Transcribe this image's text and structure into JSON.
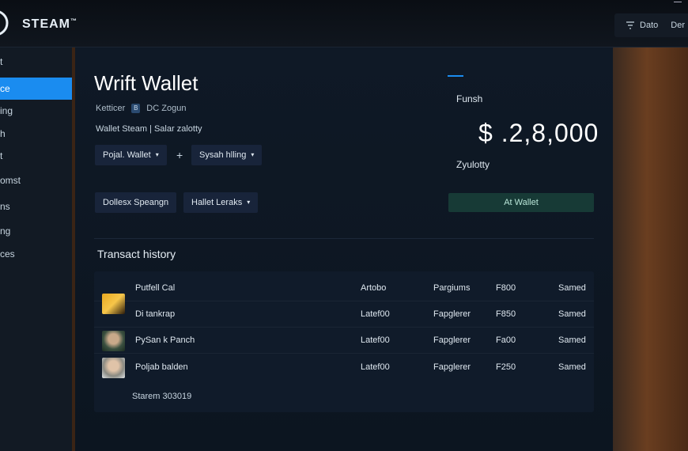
{
  "app": {
    "brand": "STEAM",
    "top_right": [
      "Dato",
      "Der"
    ]
  },
  "sidebar": {
    "items": [
      {
        "label": "t",
        "active": false
      },
      {
        "label": "ce",
        "active": true
      },
      {
        "label": "ing",
        "active": false
      },
      {
        "label": "h",
        "active": false
      },
      {
        "label": "t",
        "active": false
      },
      {
        "label": "omst",
        "active": false
      },
      {
        "label": "ns",
        "active": false
      },
      {
        "label": "ng",
        "active": false
      },
      {
        "label": "ces",
        "active": false
      }
    ]
  },
  "wallet": {
    "title": "Wrift Wallet",
    "meta_left": "Ketticer",
    "meta_badge": "B",
    "meta_right": "DC Zogun",
    "subline": "Wallet Steam | Salar zalotty",
    "btn_wallet": "Pojal. Wallet",
    "plus": "+",
    "btn_billing": "Sysah hlling",
    "btn_spending": "Dollesx Speangn",
    "btn_leraks": "Hallet Leraks"
  },
  "balance": {
    "label": "Funsh",
    "value": "$ .2,8,000",
    "sub": "Zyulotty",
    "add_button": "At Wallet"
  },
  "history": {
    "title": "Transact history",
    "rows": [
      {
        "name": "Putfell Cal",
        "c2": "Artobo",
        "c3": "Pargiums",
        "c4": "F800",
        "c5": "Samed"
      },
      {
        "name": "Di tankrap",
        "c2": "Latef00",
        "c3": "Fapglerer",
        "c4": "F850",
        "c5": "Samed"
      },
      {
        "name": "PySan k Panch",
        "c2": "Latef00",
        "c3": "Fapglerer",
        "c4": "Fa00",
        "c5": "Samed"
      },
      {
        "name": "Poljab balden",
        "c2": "Latef00",
        "c3": "Fapglerer",
        "c4": "F250",
        "c5": "Samed"
      }
    ],
    "footer": "Starem 303019"
  },
  "colors": {
    "accent": "#1a8cf0",
    "add_wallet_bg": "#173a36"
  }
}
